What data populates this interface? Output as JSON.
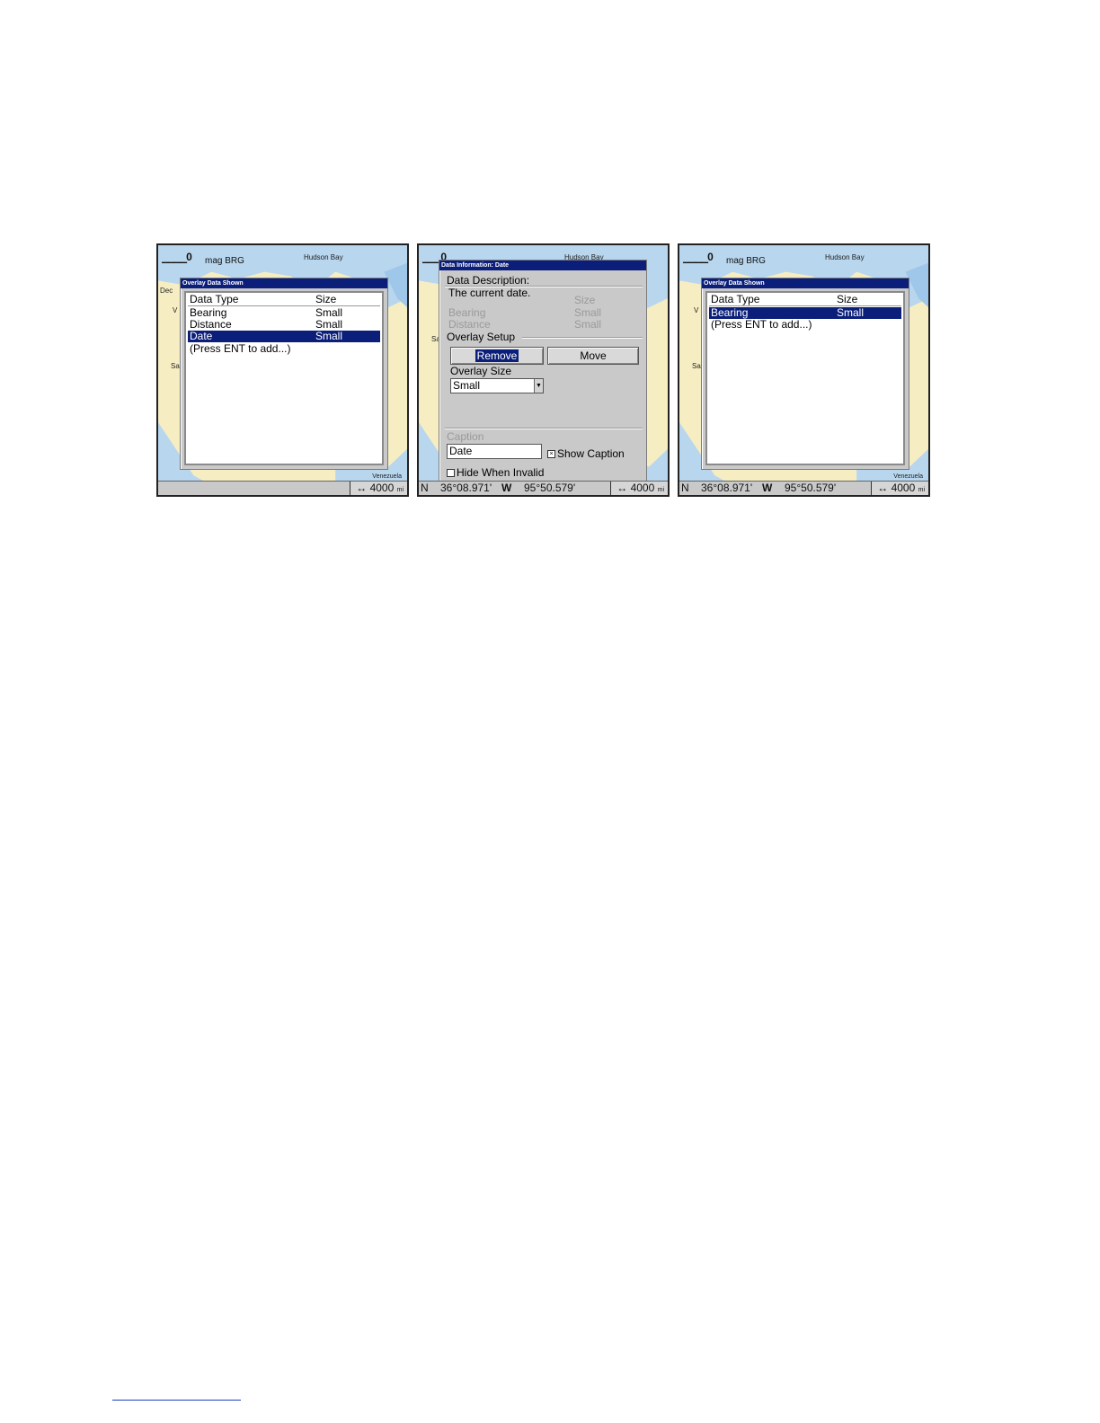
{
  "map": {
    "scale_zero": "0",
    "mag_label": "mag BRG",
    "hudson_label": "Hudson Bay",
    "venezuela_label": "Venezuela",
    "side_label_dec": "Dec",
    "side_label_v": "V",
    "side_label_sa": "Sa",
    "scale_value": "↔ 4000",
    "scale_unit": "mi",
    "lat_hemisphere": "N",
    "latitude": "36°08.971'",
    "lon_hemisphere": "W",
    "longitude": "95°50.579'"
  },
  "panel1": {
    "title": "Overlay Data Shown",
    "header": {
      "type": "Data Type",
      "size": "Size"
    },
    "rows": [
      {
        "type": "Bearing",
        "size": "Small"
      },
      {
        "type": "Distance",
        "size": "Small"
      },
      {
        "type": "Date",
        "size": "Small"
      }
    ],
    "add_hint": "(Press ENT to add...)",
    "selected_index": 2
  },
  "panel2": {
    "title": "Data Information: Date",
    "description_label": "Data Description:",
    "description_text": "The current date.",
    "ghost_rows": [
      {
        "type": "Bearing",
        "size": "Small"
      },
      {
        "type": "Distance",
        "size": "Small"
      }
    ],
    "ghost_size_header": "Size",
    "overlay_setup_label": "Overlay Setup",
    "remove_button": "Remove",
    "move_button": "Move",
    "overlay_size_label": "Overlay Size",
    "overlay_size_value": "Small",
    "caption_label": "Caption",
    "caption_value": "Date",
    "show_caption_label": "Show Caption",
    "show_caption_checked": true,
    "hide_invalid_label": "Hide When Invalid",
    "hide_invalid_checked": false
  },
  "panel3": {
    "title": "Overlay Data Shown",
    "header": {
      "type": "Data Type",
      "size": "Size"
    },
    "rows": [
      {
        "type": "Bearing",
        "size": "Small"
      }
    ],
    "add_hint": "(Press ENT to add...)",
    "selected_index": 0
  }
}
